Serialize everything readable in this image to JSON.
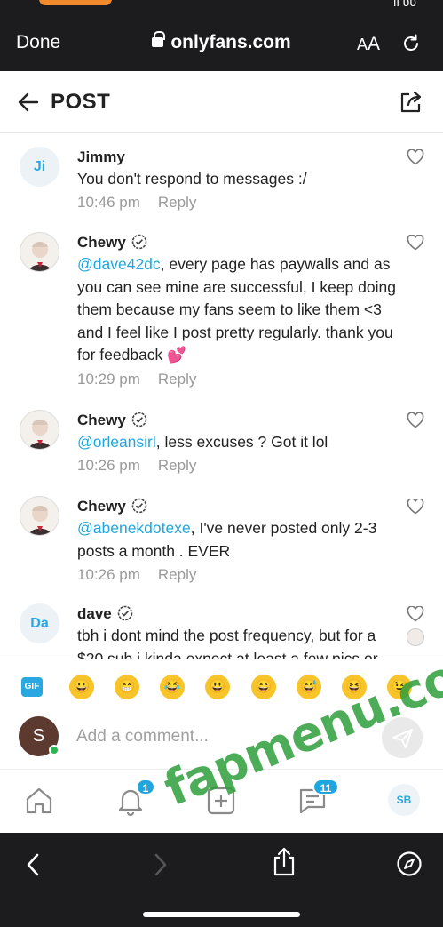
{
  "browser": {
    "done_label": "Done",
    "url": "onlyfans.com",
    "text_size_label_small": "A",
    "text_size_label_big": "A",
    "status_right": "ıl ᴜᴜ"
  },
  "post_header": {
    "title": "POST"
  },
  "comments": [
    {
      "author": "Jimmy",
      "initials": "Ji",
      "verified": false,
      "mention": "",
      "text": "You don't respond to messages :/",
      "time": "10:46 pm",
      "reply_label": "Reply"
    },
    {
      "author": "Chewy",
      "verified": true,
      "mention": "@dave42dc",
      "text": ", every page has paywalls and as you can see mine are successful, I keep doing them because my fans seem to like them <3 and I feel like I post pretty regularly. thank you for feedback 💕",
      "time": "10:29 pm",
      "reply_label": "Reply"
    },
    {
      "author": "Chewy",
      "verified": true,
      "mention": "@orleansirl",
      "text": ", less excuses ? Got it lol",
      "time": "10:26 pm",
      "reply_label": "Reply"
    },
    {
      "author": "Chewy",
      "verified": true,
      "mention": "@abenekdotexe",
      "text": ", I've never posted only 2-3 posts a month . EVER",
      "time": "10:26 pm",
      "reply_label": "Reply"
    },
    {
      "author": "dave",
      "initials": "Da",
      "verified": true,
      "mention": "",
      "text": "tbh i dont mind the post frequency, but for a $20 sub i kinda expect at least a few pics or",
      "time": "",
      "reply_label": ""
    }
  ],
  "emoji_bar": {
    "gif_label": "GIF",
    "emojis": [
      "😀",
      "😁",
      "😂",
      "😃",
      "😄",
      "😅",
      "😆",
      "😉"
    ]
  },
  "comment_input": {
    "placeholder": "Add a comment...",
    "user_initial": "S"
  },
  "bottom_nav": {
    "notifications_count": "1",
    "messages_count": "11",
    "profile_initials": "SB"
  },
  "watermark": "fapmenu.com",
  "colors": {
    "accent": "#22a6de",
    "online": "#2bb553",
    "browser_bg": "#1c1c1e"
  }
}
